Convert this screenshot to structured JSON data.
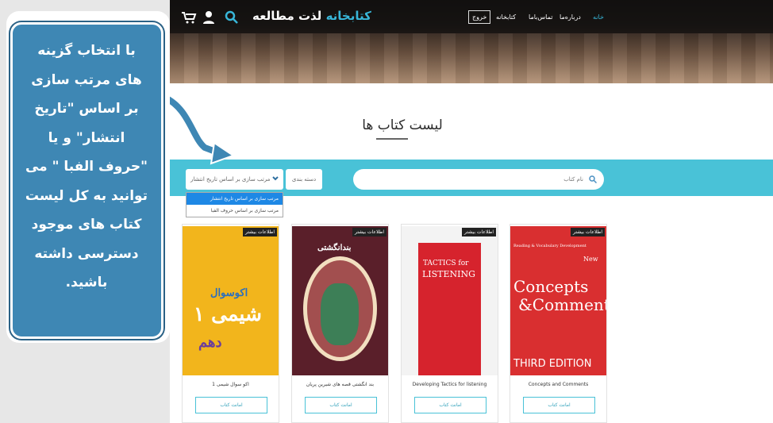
{
  "callout": {
    "text": "با انتخاب گزینه های مرتب سازی بر اساس \"تاریخ انتشار\" و یا \"حروف الفبا \" می توانید به کل لیست کتاب های موجود دسترسی داشته باشید."
  },
  "header": {
    "brand_main": "لذت مطالعه",
    "brand_accent": "کتابخانه",
    "logout": "خروج",
    "nav": [
      "خانه",
      "درباره‌ما",
      "تماس‌باما",
      "کتابخانه"
    ],
    "icons": [
      "search-icon",
      "user-icon",
      "cart-icon"
    ]
  },
  "page": {
    "title": "لیست کتاب ها"
  },
  "filters": {
    "sort_selected": "مرتب سازی بر اساس تاریخ انتشار",
    "sort_options": [
      "مرتب سازی بر اساس تاریخ انتشار",
      "مرتب سازی بر اساس حروف الفبا"
    ],
    "category": "دسته بندی",
    "search_placeholder": "نام کتاب"
  },
  "books": [
    {
      "title": "اکو سوال شیمی 1",
      "more": "اطلاعات بیشتر",
      "borrow": "امانت کتاب",
      "cover_line1": "اکوسوال",
      "cover_line2": "شیمی ۱",
      "cover_line3": "دهم"
    },
    {
      "title": "بند انگشتی قصه های شیرین پریان",
      "more": "اطلاعات بیشتر",
      "borrow": "امانت کتاب",
      "cover_line1": "بندانگشتی"
    },
    {
      "title": "Developing Tactics for listening",
      "more": "اطلاعات بیشتر",
      "borrow": "امانت کتاب",
      "cover_line1": "TACTICS for",
      "cover_line2": "LISTENING"
    },
    {
      "title": "Concepts and Comments",
      "more": "اطلاعات بیشتر",
      "borrow": "امانت کتاب",
      "cover_line1": "Reading & Vocabulary Development",
      "cover_line2": "Concepts",
      "cover_line3": "&Comments",
      "cover_line4": "THIRD EDITION",
      "cover_line5": "New"
    }
  ],
  "colors": {
    "accent": "#49c2d7",
    "callout": "#3e87b4",
    "selected": "#1e88e5"
  }
}
